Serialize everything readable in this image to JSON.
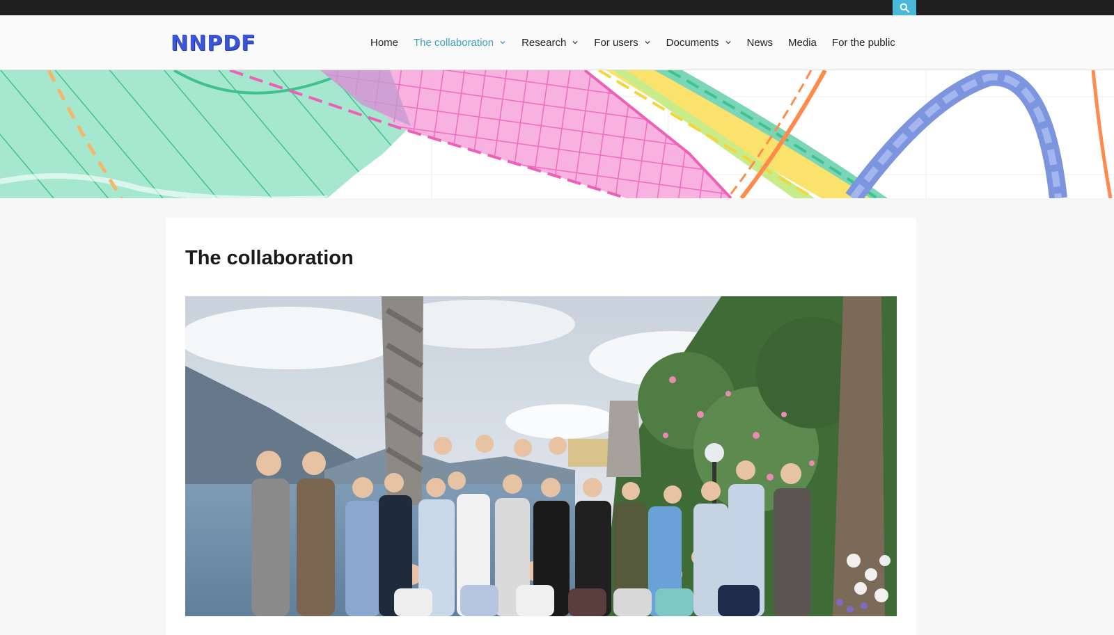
{
  "topbar": {
    "search_icon": "search-icon"
  },
  "logo": {
    "text": "NNPDF"
  },
  "nav": {
    "items": [
      {
        "label": "Home",
        "dropdown": false,
        "active": false
      },
      {
        "label": "The collaboration",
        "dropdown": true,
        "active": true
      },
      {
        "label": "Research",
        "dropdown": true,
        "active": false
      },
      {
        "label": "For users",
        "dropdown": true,
        "active": false
      },
      {
        "label": "Documents",
        "dropdown": true,
        "active": false
      },
      {
        "label": "News",
        "dropdown": false,
        "active": false
      },
      {
        "label": "Media",
        "dropdown": false,
        "active": false
      },
      {
        "label": "For the public",
        "dropdown": false,
        "active": false
      }
    ]
  },
  "page": {
    "title": "The collaboration"
  },
  "colors": {
    "accent": "#48b9d9",
    "active_nav": "#3ba0b9",
    "topbar": "#1f1f1f"
  }
}
